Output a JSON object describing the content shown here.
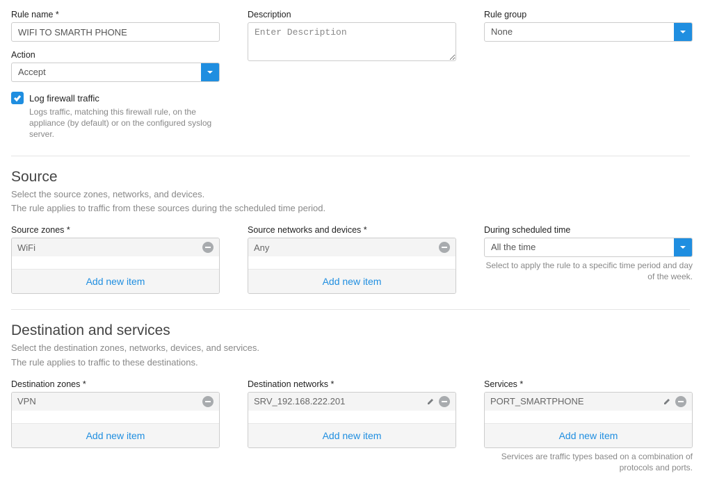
{
  "top": {
    "rule_name_label": "Rule name *",
    "rule_name_value": "WIFI TO SMARTH PHONE",
    "description_label": "Description",
    "description_placeholder": "Enter Description",
    "rule_group_label": "Rule group",
    "rule_group_value": "None",
    "action_label": "Action",
    "action_value": "Accept",
    "log_label": "Log firewall traffic",
    "log_helper": "Logs traffic, matching this firewall rule, on the appliance (by default) or on the configured syslog server."
  },
  "source": {
    "title": "Source",
    "sub1": "Select the source zones, networks, and devices.",
    "sub2": "The rule applies to traffic from these sources during the scheduled time period.",
    "zones_label": "Source zones *",
    "zones_chip": "WiFi",
    "nets_label": "Source networks and devices *",
    "nets_chip": "Any",
    "sched_label": "During scheduled time",
    "sched_value": "All the time",
    "sched_helper": "Select to apply the rule to a specific time period and day of the week.",
    "add_item": "Add new item"
  },
  "dest": {
    "title": "Destination and services",
    "sub1": "Select the destination zones, networks, devices, and services.",
    "sub2": "The rule applies to traffic to these destinations.",
    "zones_label": "Destination zones *",
    "zones_chip": "VPN",
    "nets_label": "Destination networks *",
    "nets_chip": "SRV_192.168.222.201",
    "services_label": "Services *",
    "services_chip": "PORT_SMARTPHONE",
    "services_helper": "Services are traffic types based on a combination of protocols and ports.",
    "add_item": "Add new item"
  }
}
